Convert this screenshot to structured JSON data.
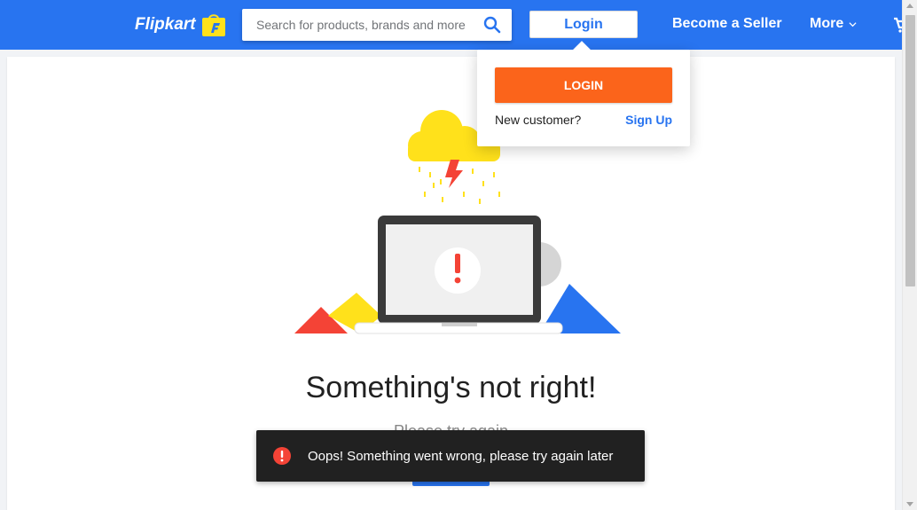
{
  "header": {
    "logo_text": "Flipkart",
    "search_placeholder": "Search for products, brands and more",
    "login_label": "Login",
    "seller_label": "Become a Seller",
    "more_label": "More"
  },
  "login_dropdown": {
    "login_button": "LOGIN",
    "new_customer": "New customer?",
    "signup_link": "Sign Up"
  },
  "error_page": {
    "headline": "Something's not right!",
    "subtext": "Please try again"
  },
  "toast": {
    "message": "Oops! Something went wrong, please try again later"
  },
  "colors": {
    "brand_blue": "#2874f0",
    "login_orange": "#fb641b",
    "logo_yellow": "#ffe11b",
    "alert_red": "#f44336"
  },
  "icons": [
    "search-icon",
    "chevron-down-icon",
    "cart-icon",
    "alert-icon",
    "logo-bag-icon"
  ]
}
